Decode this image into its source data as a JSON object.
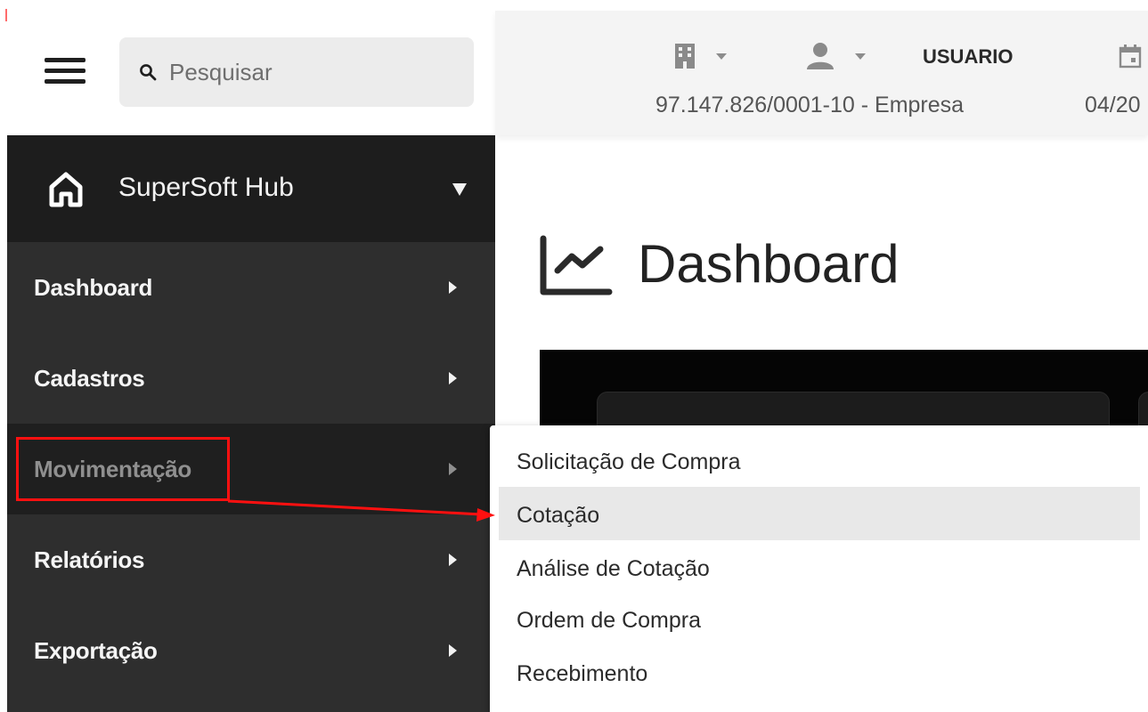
{
  "search": {
    "placeholder": "Pesquisar"
  },
  "header": {
    "user_label": "USUARIO",
    "company": "97.147.826/0001-10 - Empresa",
    "date": "04/20"
  },
  "sidebar": {
    "title": "SuperSoft Hub",
    "items": [
      {
        "label": "Dashboard"
      },
      {
        "label": "Cadastros"
      },
      {
        "label": "Movimentação",
        "active": true
      },
      {
        "label": "Relatórios"
      },
      {
        "label": "Exportação"
      }
    ]
  },
  "main": {
    "title": "Dashboard"
  },
  "submenu": {
    "items": [
      {
        "label": "Solicitação de Compra"
      },
      {
        "label": "Cotação",
        "highlighted": true
      },
      {
        "label": "Análise de Cotação"
      },
      {
        "label": "Ordem de Compra"
      },
      {
        "label": "Recebimento"
      }
    ]
  },
  "colors": {
    "sidebar_header": "#1d1d1d",
    "sidebar_menu": "#2e2e2e",
    "annotation": "#ff1010",
    "highlight": "#e8e8e8"
  }
}
